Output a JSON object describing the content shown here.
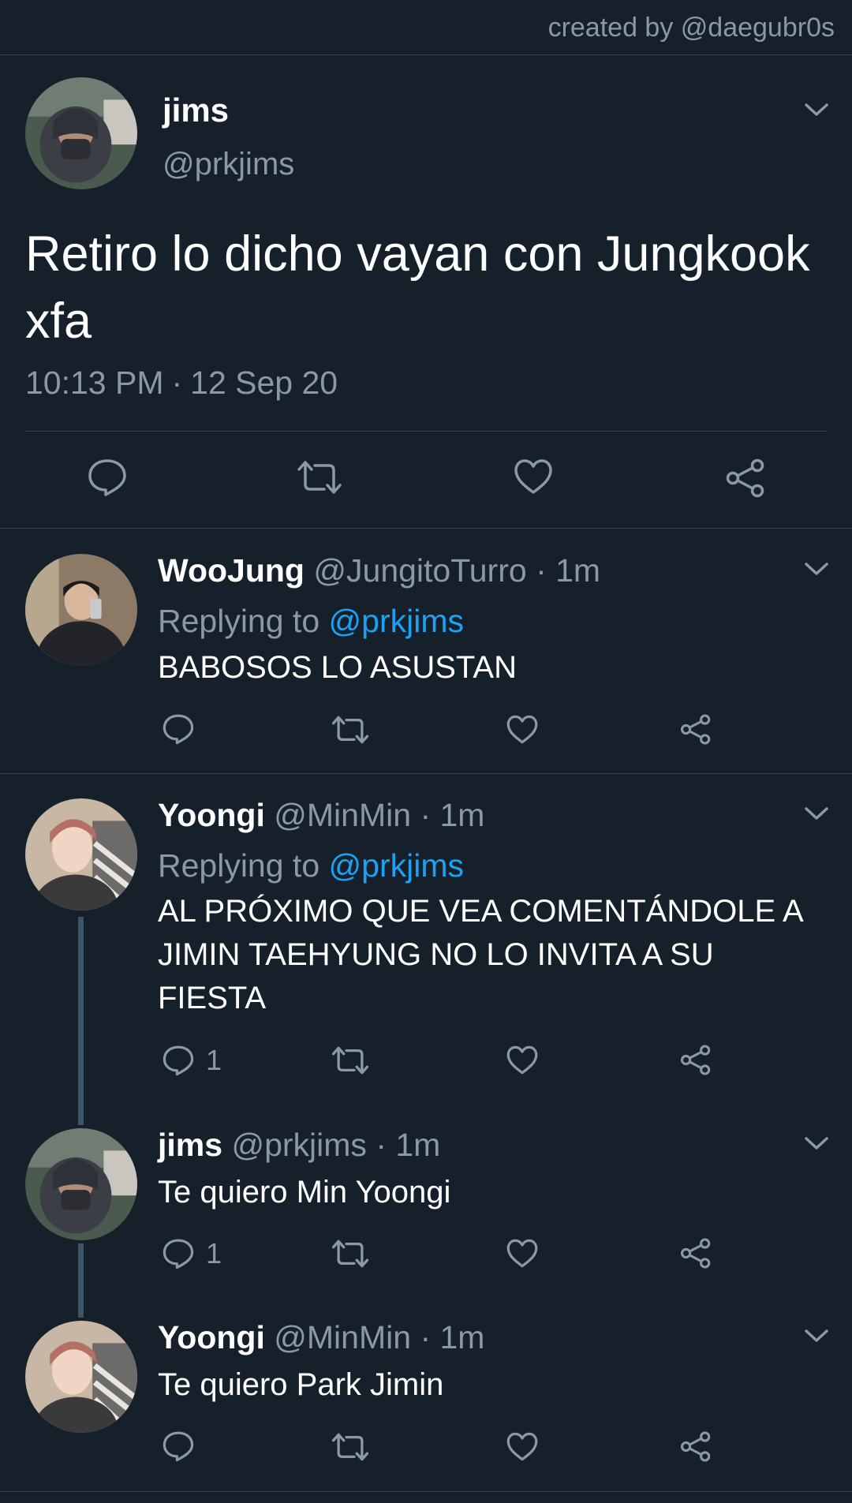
{
  "credit": "created by @daegubr0s",
  "main_tweet": {
    "name": "jims",
    "handle": "@prkjims",
    "text": "Retiro lo dicho vayan con Jungkook xfa",
    "time": "10:13 PM",
    "date": "12 Sep 20"
  },
  "replies": [
    {
      "name": "WooJung",
      "handle": "@JungitoTurro",
      "time": "1m",
      "replying_label": "Replying to",
      "replying_to": "@prkjims",
      "text": "BABOSOS LO ASUSTAN",
      "reply_count": ""
    },
    {
      "name": "Yoongi",
      "handle": "@MinMin",
      "time": "1m",
      "replying_label": "Replying to",
      "replying_to": "@prkjims",
      "text": "AL PRÓXIMO QUE VEA COMENTÁNDOLE A JIMIN TAEHYUNG NO LO INVITA A SU FIESTA",
      "reply_count": "1"
    },
    {
      "name": "jims",
      "handle": "@prkjims",
      "time": "1m",
      "text": "Te quiero Min Yoongi",
      "reply_count": "1"
    },
    {
      "name": "Yoongi",
      "handle": "@MinMin",
      "time": "1m",
      "text": "Te quiero Park Jimin",
      "reply_count": ""
    }
  ],
  "icons": [
    "reply-icon",
    "retweet-icon",
    "like-icon",
    "share-icon",
    "chevron-down-icon"
  ],
  "colors": {
    "background": "#15202b",
    "muted": "#8b98a5",
    "link": "#1da1f2",
    "divider": "#38444d",
    "thread": "#3d5466"
  }
}
